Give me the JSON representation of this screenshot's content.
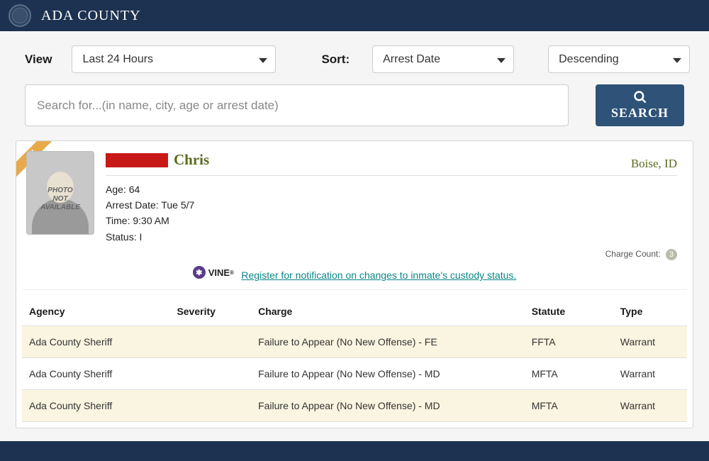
{
  "header": {
    "title": "ADA COUNTY"
  },
  "filters": {
    "view_label": "View",
    "view_value": "Last 24 Hours",
    "sort_label": "Sort:",
    "sort_value": "Arrest Date",
    "order_value": "Descending"
  },
  "search": {
    "placeholder": "Search for...(in name, city, age or arrest date)",
    "button_label": "SEARCH"
  },
  "inmate": {
    "ribbon": "IN",
    "photo_text_1": "PHOTO",
    "photo_text_2": "NOT",
    "photo_text_3": "AVAILABLE",
    "first_name": "Chris",
    "location": "Boise, ID",
    "age_label": "Age:",
    "age_value": "64",
    "arrest_date_label": "Arrest Date:",
    "arrest_date_value": "Tue 5/7",
    "time_label": "Time:",
    "time_value": "9:30 AM",
    "status_label": "Status:",
    "status_value": "I",
    "charge_count_label": "Charge Count:",
    "charge_count_value": "3",
    "vine_label": "VINE",
    "vine_link": " Register for notification on changes to inmate's custody status."
  },
  "charges": {
    "headers": {
      "agency": "Agency",
      "severity": "Severity",
      "charge": "Charge",
      "statute": "Statute",
      "type": "Type"
    },
    "rows": [
      {
        "agency": "Ada County Sheriff",
        "severity": "",
        "charge": "Failure to Appear (No New Offense) - FE",
        "statute": "FFTA",
        "type": "Warrant"
      },
      {
        "agency": "Ada County Sheriff",
        "severity": "",
        "charge": "Failure to Appear (No New Offense) - MD",
        "statute": "MFTA",
        "type": "Warrant"
      },
      {
        "agency": "Ada County Sheriff",
        "severity": "",
        "charge": "Failure to Appear (No New Offense) - MD",
        "statute": "MFTA",
        "type": "Warrant"
      }
    ]
  }
}
